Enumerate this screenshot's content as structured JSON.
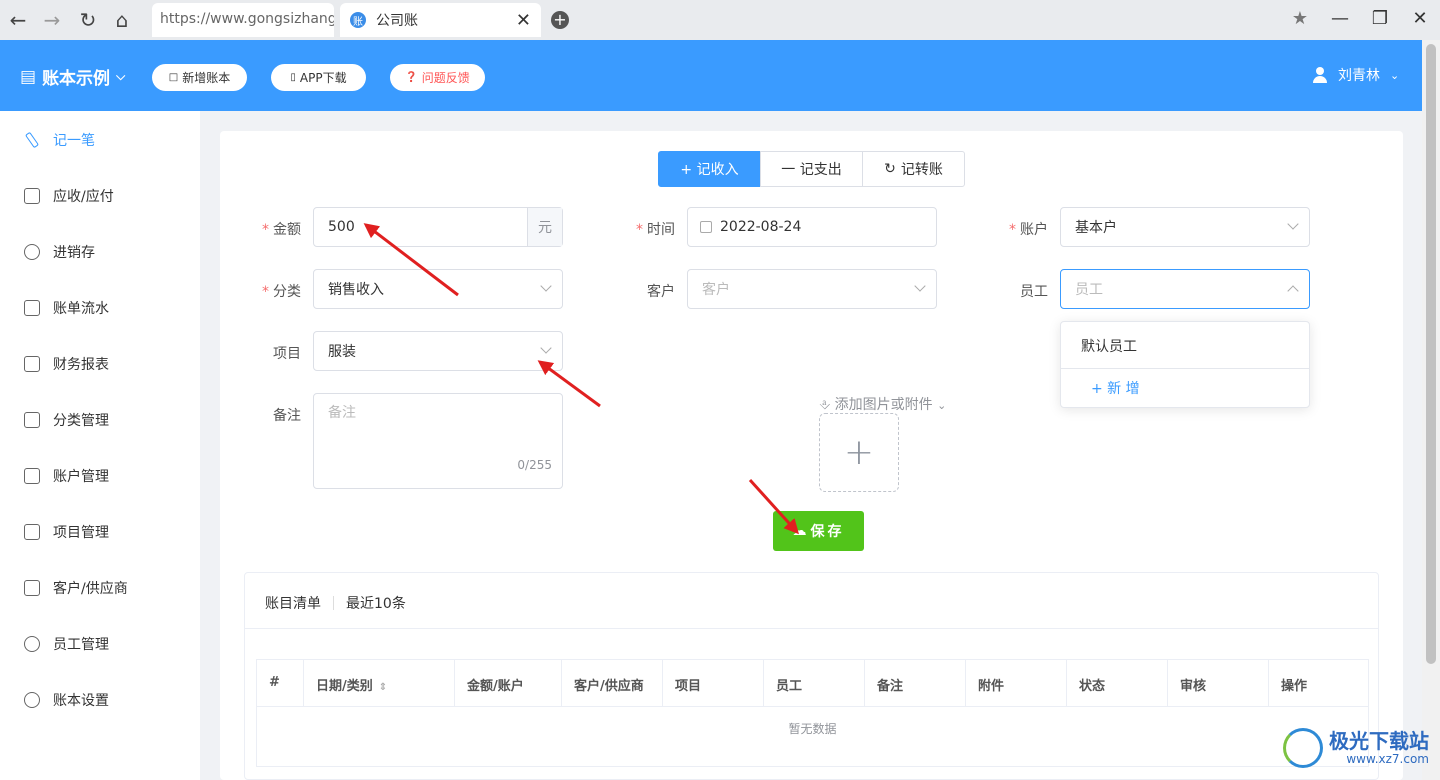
{
  "browser": {
    "url": "https://www.gongsizhang.c",
    "tab_title": "公司账",
    "tab_fav": "账"
  },
  "header": {
    "book_title": "账本示例",
    "btn_new_book": "新增账本",
    "btn_app": "APP下载",
    "btn_feedback": "问题反馈",
    "user": "刘青林"
  },
  "sidebar": {
    "items": [
      {
        "label": "记一笔"
      },
      {
        "label": "应收/应付"
      },
      {
        "label": "进销存"
      },
      {
        "label": "账单流水"
      },
      {
        "label": "财务报表"
      },
      {
        "label": "分类管理"
      },
      {
        "label": "账户管理"
      },
      {
        "label": "项目管理"
      },
      {
        "label": "客户/供应商"
      },
      {
        "label": "员工管理"
      },
      {
        "label": "账本设置"
      }
    ]
  },
  "tabs": {
    "income": "+ 记收入",
    "expense": "一 记支出",
    "transfer": "记转账"
  },
  "form": {
    "amount_label": "金额",
    "amount_value": "500",
    "amount_unit": "元",
    "time_label": "时间",
    "time_value": "2022-08-24",
    "account_label": "账户",
    "account_value": "基本户",
    "category_label": "分类",
    "category_value": "销售收入",
    "customer_label": "客户",
    "customer_placeholder": "客户",
    "staff_label": "员工",
    "staff_placeholder": "员工",
    "project_label": "项目",
    "project_value": "服装",
    "note_label": "备注",
    "note_placeholder": "备注",
    "note_counter": "0/255",
    "attach_label": "添加图片或附件",
    "save": "保存",
    "required_mark": "*"
  },
  "staff_dropdown": {
    "option": "默认员工",
    "add": "+ 新 增"
  },
  "list": {
    "tab_list": "账目清单",
    "tab_recent": "最近10条",
    "columns": [
      "#",
      "日期/类别",
      "金额/账户",
      "客户/供应商",
      "项目",
      "员工",
      "备注",
      "附件",
      "状态",
      "审核",
      "操作"
    ],
    "empty": "暂无数据"
  },
  "watermark": {
    "name": "极光下载站",
    "site": "www.xz7.com"
  },
  "colors": {
    "primary": "#3a9bff",
    "save": "#52c41a",
    "annotation_arrow": "#e02020"
  }
}
